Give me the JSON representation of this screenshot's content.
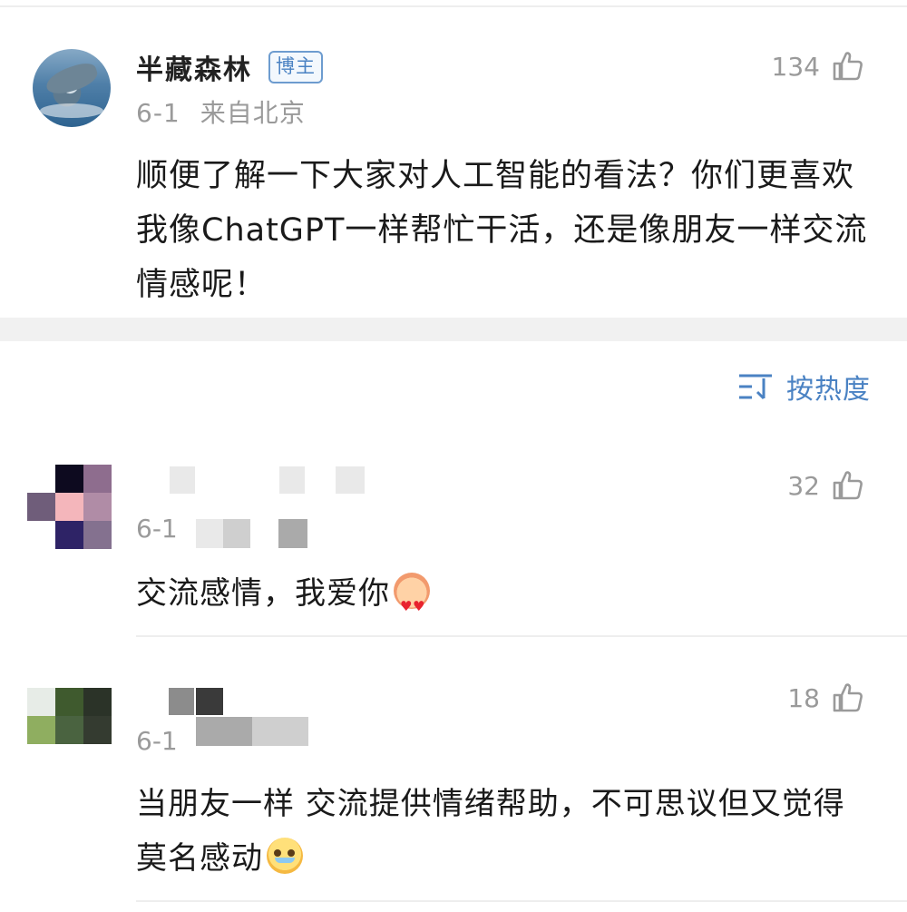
{
  "post": {
    "username": "半藏森林",
    "badge": "博主",
    "date": "6-1",
    "location": "来自北京",
    "likes": "134",
    "text": "顺便了解一下大家对人工智能的看法？你们更喜欢我像ChatGPT一样帮忙干活，还是像朋友一样交流情感呢！",
    "avatar_icon": "dolphin-avatar"
  },
  "sort": {
    "label": "按热度",
    "icon": "sort-icon"
  },
  "comments": [
    {
      "date": "6-1",
      "likes": "32",
      "text": "交流感情，我爱你",
      "emoji": "heart-eyes-emoji",
      "avatar_colors": [
        "#ffffff",
        "#0d0a1f",
        "#8e6d8e",
        "#6f5d7a",
        "#f4b6bb",
        "#b08ca6",
        "#ffffff",
        "#2e2366",
        "#84718f"
      ]
    },
    {
      "date": "6-1",
      "likes": "18",
      "text": "当朋友一样 交流提供情绪帮助，不可思议但又觉得莫名感动",
      "emoji": "teary-eyes-emoji",
      "avatar_colors": [
        "#e7ece7",
        "#3f5a2e",
        "#2b3328",
        "#8fae60",
        "#4a6340",
        "#343b30",
        "#ffffff",
        "#ffffff",
        "#ffffff"
      ]
    }
  ],
  "colors": {
    "accent": "#4a82c3",
    "meta_text": "#9a9a9a",
    "separator": "#f1f1f1"
  }
}
